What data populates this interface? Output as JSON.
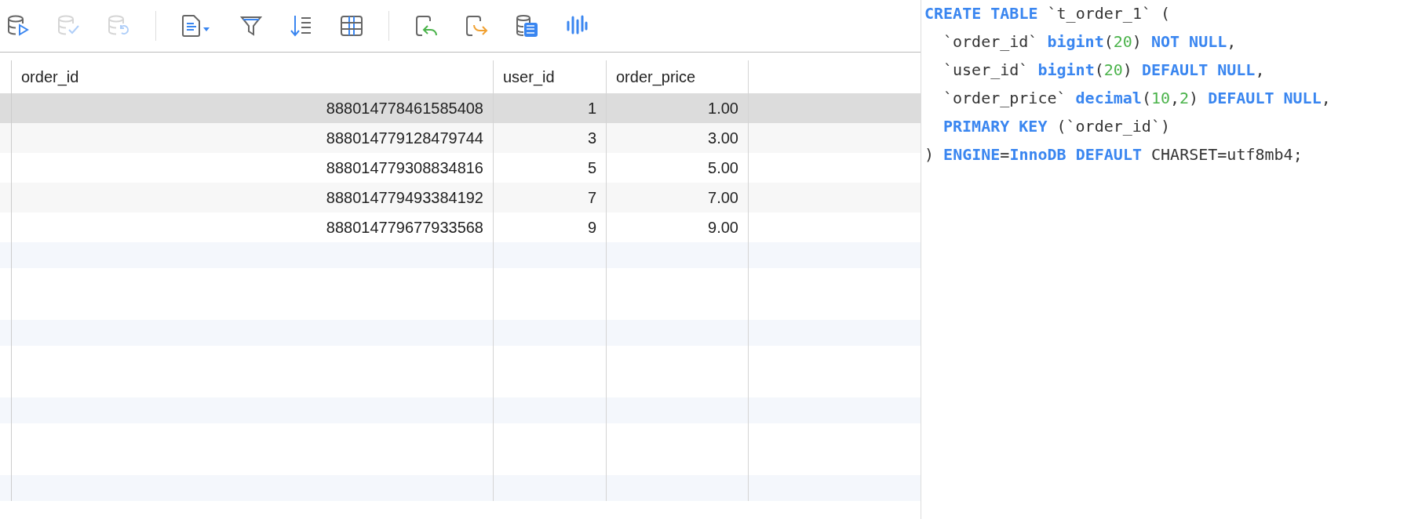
{
  "toolbar": [
    {
      "kind": "run",
      "disabled": false
    },
    {
      "kind": "commit",
      "disabled": true
    },
    {
      "kind": "rollback",
      "disabled": true
    },
    {
      "kind": "separator"
    },
    {
      "kind": "document",
      "disabled": false
    },
    {
      "kind": "filter",
      "disabled": false
    },
    {
      "kind": "sort",
      "disabled": false
    },
    {
      "kind": "grid",
      "disabled": false
    },
    {
      "kind": "separator"
    },
    {
      "kind": "import",
      "disabled": false
    },
    {
      "kind": "export",
      "disabled": false
    },
    {
      "kind": "datatype",
      "disabled": false
    },
    {
      "kind": "chart",
      "disabled": false
    }
  ],
  "table": {
    "columns": [
      "order_id",
      "user_id",
      "order_price"
    ],
    "rows": [
      {
        "cells": [
          "888014778461585408",
          "1",
          "1.00"
        ],
        "selected": true
      },
      {
        "cells": [
          "888014779128479744",
          "3",
          "3.00"
        ],
        "selected": false
      },
      {
        "cells": [
          "888014779308834816",
          "5",
          "5.00"
        ],
        "selected": false
      },
      {
        "cells": [
          "888014779493384192",
          "7",
          "7.00"
        ],
        "selected": false
      },
      {
        "cells": [
          "888014779677933568",
          "9",
          "9.00"
        ],
        "selected": false
      }
    ]
  },
  "ddl": [
    {
      "indent": false,
      "tokens": [
        {
          "kind": "keyword",
          "text": "CREATE TABLE"
        },
        {
          "kind": "plain",
          "text": " `t_order_1` ("
        }
      ]
    },
    {
      "indent": true,
      "tokens": [
        {
          "kind": "plain",
          "text": "`order_id` "
        },
        {
          "kind": "keyword",
          "text": "bigint"
        },
        {
          "kind": "plain",
          "text": "("
        },
        {
          "kind": "number",
          "text": "20"
        },
        {
          "kind": "plain",
          "text": ") "
        },
        {
          "kind": "keyword",
          "text": "NOT NULL"
        },
        {
          "kind": "plain",
          "text": ","
        }
      ]
    },
    {
      "indent": true,
      "tokens": [
        {
          "kind": "plain",
          "text": "`user_id` "
        },
        {
          "kind": "keyword",
          "text": "bigint"
        },
        {
          "kind": "plain",
          "text": "("
        },
        {
          "kind": "number",
          "text": "20"
        },
        {
          "kind": "plain",
          "text": ") "
        },
        {
          "kind": "keyword",
          "text": "DEFAULT NULL"
        },
        {
          "kind": "plain",
          "text": ","
        }
      ]
    },
    {
      "indent": true,
      "tokens": [
        {
          "kind": "plain",
          "text": "`order_price` "
        },
        {
          "kind": "keyword",
          "text": "decimal"
        },
        {
          "kind": "plain",
          "text": "("
        },
        {
          "kind": "number",
          "text": "10"
        },
        {
          "kind": "plain",
          "text": ","
        },
        {
          "kind": "number",
          "text": "2"
        },
        {
          "kind": "plain",
          "text": ") "
        },
        {
          "kind": "keyword",
          "text": "DEFAULT NULL"
        },
        {
          "kind": "plain",
          "text": ","
        }
      ]
    },
    {
      "indent": true,
      "tokens": [
        {
          "kind": "keyword",
          "text": "PRIMARY KEY"
        },
        {
          "kind": "plain",
          "text": " (`order_id`)"
        }
      ]
    },
    {
      "indent": false,
      "tokens": [
        {
          "kind": "plain",
          "text": ") "
        },
        {
          "kind": "keyword",
          "text": "ENGINE"
        },
        {
          "kind": "plain",
          "text": "="
        },
        {
          "kind": "keyword",
          "text": "InnoDB DEFAULT"
        },
        {
          "kind": "plain",
          "text": " CHARSET=utf8mb4;"
        }
      ]
    }
  ]
}
